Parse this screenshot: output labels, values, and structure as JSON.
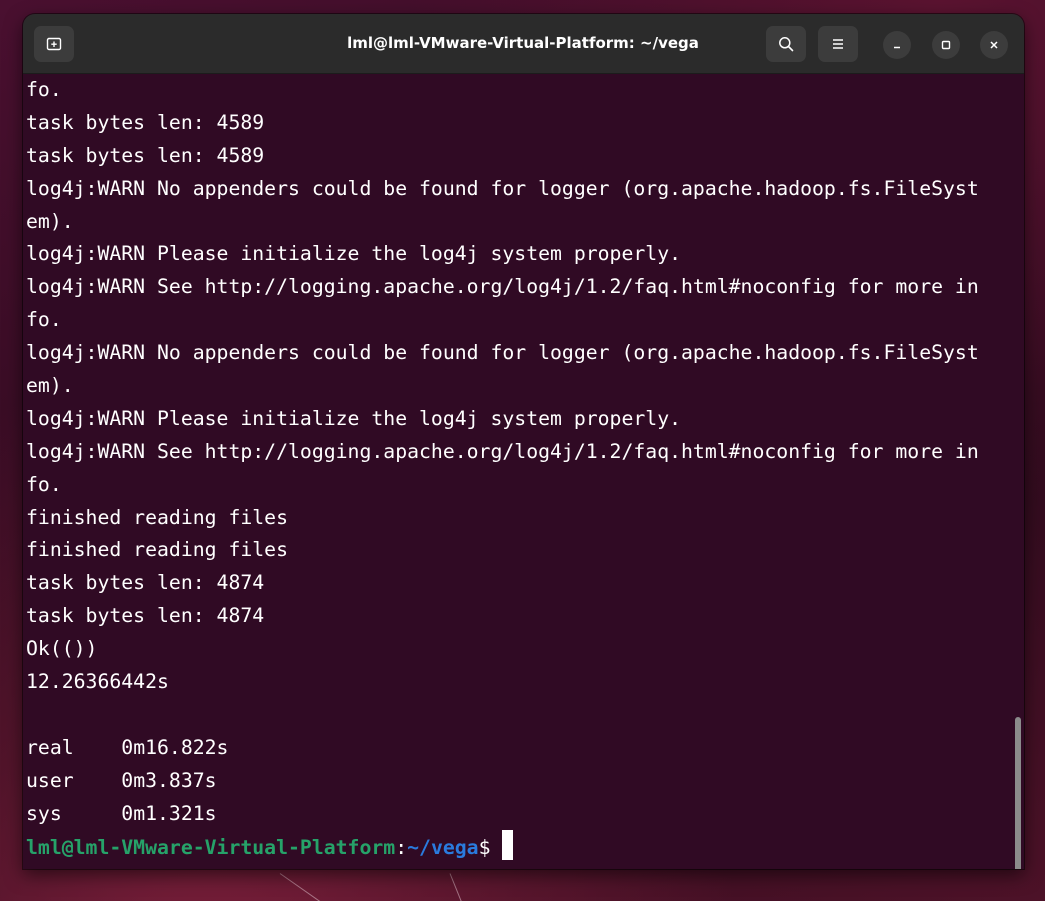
{
  "window": {
    "title": "lml@lml-VMware-Virtual-Platform: ~/vega"
  },
  "titlebar_icons": {
    "new_tab": "new-tab-icon",
    "search": "search-icon",
    "menu": "hamburger-menu-icon",
    "minimize": "minimize-icon",
    "maximize": "maximize-icon",
    "close": "close-icon"
  },
  "terminal": {
    "lines": [
      "fo.",
      "task bytes len: 4589",
      "task bytes len: 4589",
      "log4j:WARN No appenders could be found for logger (org.apache.hadoop.fs.FileSyst",
      "em).",
      "log4j:WARN Please initialize the log4j system properly.",
      "log4j:WARN See http://logging.apache.org/log4j/1.2/faq.html#noconfig for more in",
      "fo.",
      "log4j:WARN No appenders could be found for logger (org.apache.hadoop.fs.FileSyst",
      "em).",
      "log4j:WARN Please initialize the log4j system properly.",
      "log4j:WARN See http://logging.apache.org/log4j/1.2/faq.html#noconfig for more in",
      "fo.",
      "finished reading files",
      "finished reading files",
      "task bytes len: 4874",
      "task bytes len: 4874",
      "Ok(())",
      "12.26366442s",
      "",
      "real\t0m16.822s",
      "user\t0m3.837s",
      "sys\t0m1.321s"
    ],
    "prompt": {
      "user_host": "lml@lml-VMware-Virtual-Platform",
      "colon": ":",
      "path": "~/vega",
      "symbol": "$ "
    }
  },
  "colors": {
    "terminal_bg": "#300a24",
    "prompt_user": "#26a269",
    "prompt_path": "#2a7bde",
    "titlebar_bg": "#2b2b2b"
  }
}
